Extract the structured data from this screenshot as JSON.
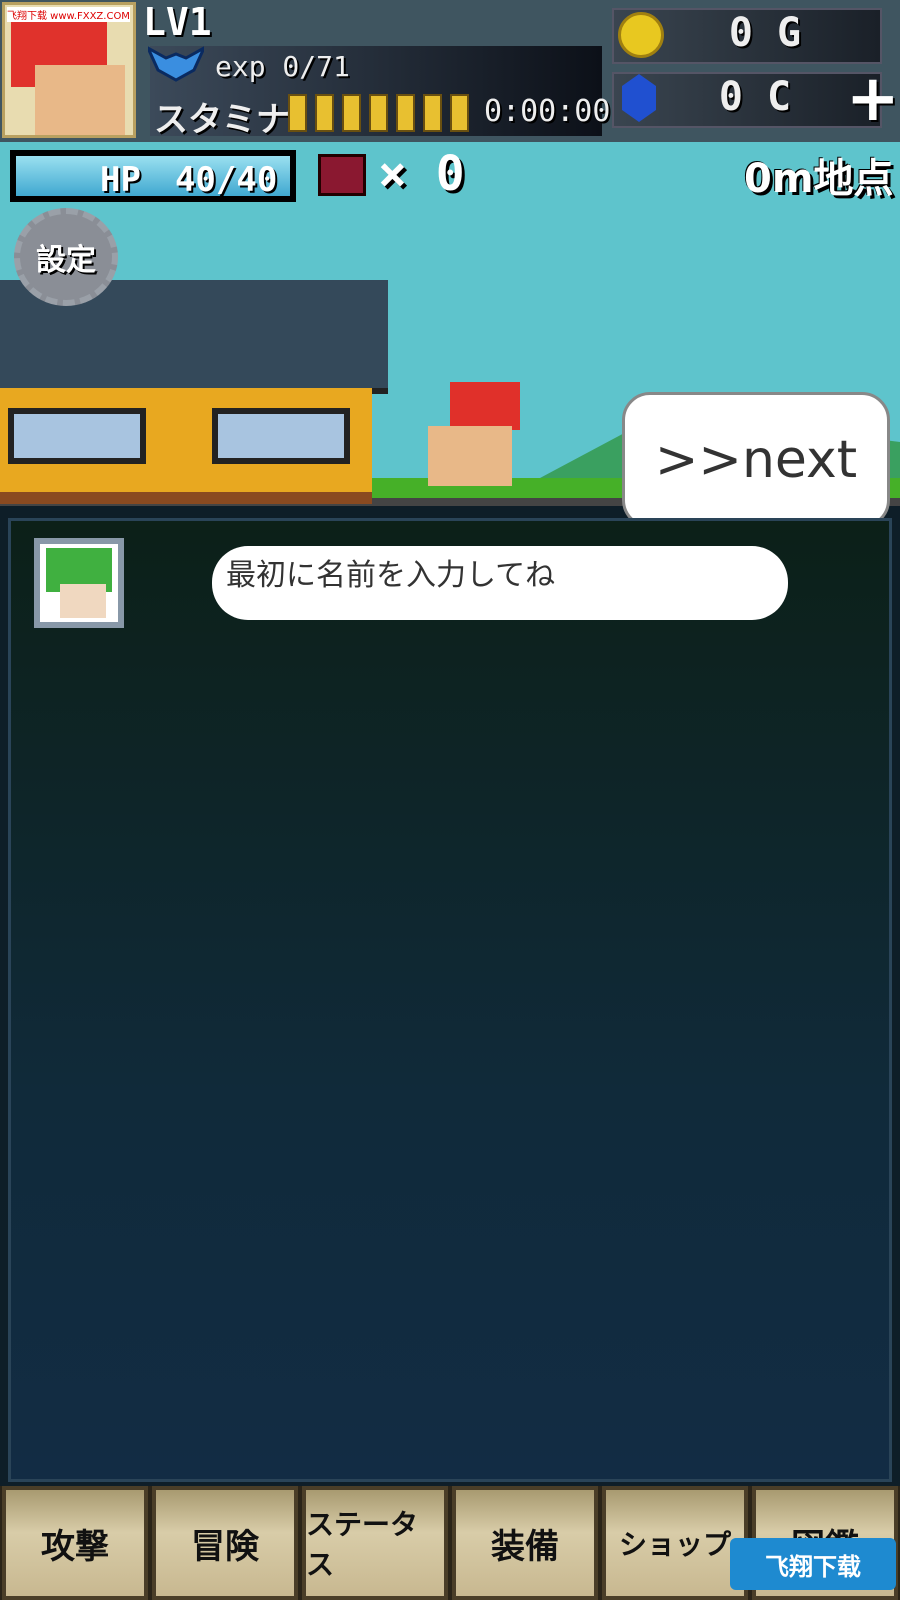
{
  "header": {
    "avatar_watermark": "飞翔下载 www.FXXZ.COM",
    "level": "LV1",
    "exp": "exp 0/71",
    "stamina_label": "スタミナ",
    "stamina_segments": 7,
    "stamina_timer": "0:00:00",
    "gold": "0 G",
    "crystal": "0 C",
    "plus_label": "+"
  },
  "scene": {
    "hp": "HP　40/40",
    "hp_fraction": 1.0,
    "chest_count": "× 0",
    "distance": "0m地点",
    "settings_label": "設定",
    "next_label": ">>next"
  },
  "dialog": {
    "message": "最初に名前を入力してね"
  },
  "tabs": [
    {
      "label": "攻撃"
    },
    {
      "label": "冒険"
    },
    {
      "label": "ステータス"
    },
    {
      "label": "装備"
    },
    {
      "label": "ショップ"
    },
    {
      "label": "図鑑"
    }
  ],
  "watermark": "飞翔下载"
}
